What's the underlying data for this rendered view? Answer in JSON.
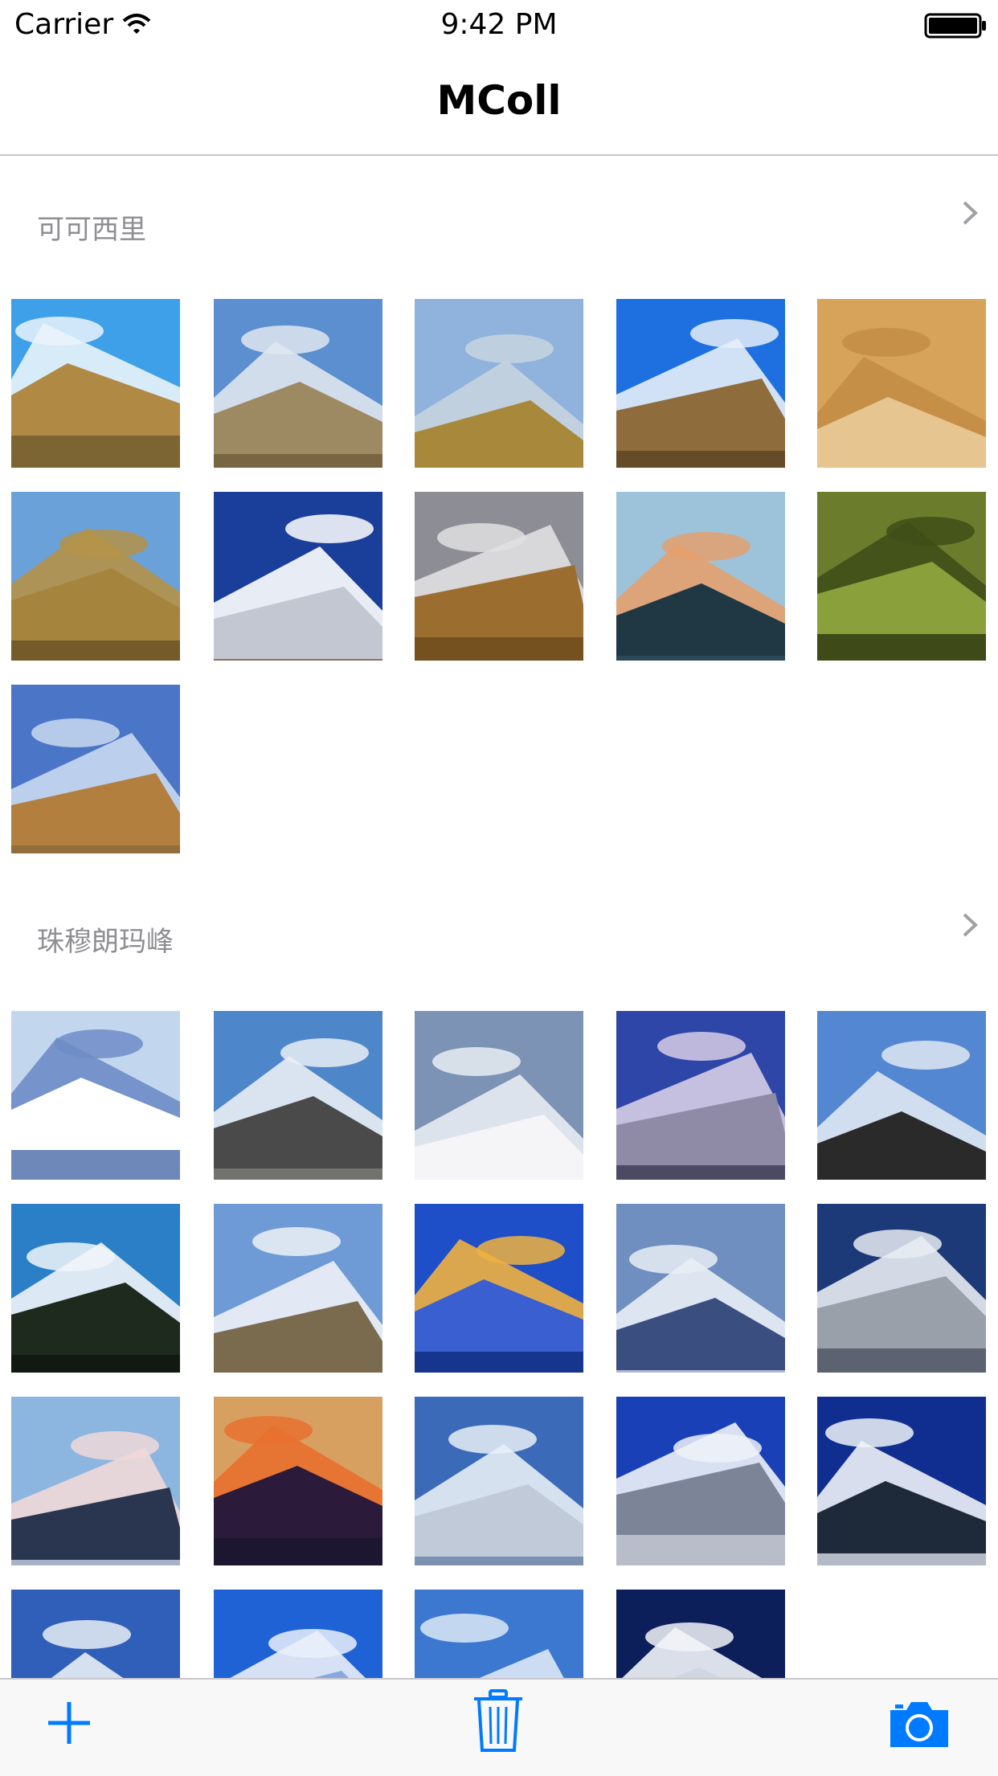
{
  "status_bar": {
    "carrier": "Carrier",
    "time": "9:42 PM"
  },
  "nav": {
    "title": "MColl"
  },
  "sections": [
    {
      "title": "可可西里",
      "photos": [
        {
          "name": "lake-shore-photo"
        },
        {
          "name": "cloudy-hill-photo"
        },
        {
          "name": "antelope-herd-photo"
        },
        {
          "name": "blue-sky-plain-photo"
        },
        {
          "name": "alpaca-photo"
        },
        {
          "name": "antelope-grassland-photo"
        },
        {
          "name": "snow-peak-photo"
        },
        {
          "name": "storm-plain-photo"
        },
        {
          "name": "sunset-lake-photo"
        },
        {
          "name": "forest-photo"
        },
        {
          "name": "deer-photo"
        }
      ]
    },
    {
      "title": "珠穆朗玛峰",
      "photos": [
        {
          "name": "cloud-sea-photo"
        },
        {
          "name": "rocky-ridge-photo"
        },
        {
          "name": "climber-slope-photo"
        },
        {
          "name": "purple-peak-photo"
        },
        {
          "name": "everest-river-photo"
        },
        {
          "name": "tree-silhouette-peak-photo"
        },
        {
          "name": "stupa-peak-photo"
        },
        {
          "name": "golden-peak-photo"
        },
        {
          "name": "cloudy-valley-photo"
        },
        {
          "name": "snow-massif-photo"
        },
        {
          "name": "pink-peak-photo"
        },
        {
          "name": "sunset-peak-photo"
        },
        {
          "name": "aerial-range-photo"
        },
        {
          "name": "wing-view-photo"
        },
        {
          "name": "cloud-peak-photo"
        },
        {
          "name": "blue-peak-photo"
        },
        {
          "name": "sky-range-photo"
        },
        {
          "name": "distant-peak-photo"
        },
        {
          "name": "white-clouds-photo"
        }
      ]
    }
  ],
  "toolbar": {
    "add_icon": "plus-icon",
    "trash_icon": "trash-icon",
    "camera_icon": "camera-icon"
  },
  "colors": {
    "accent": "#007aff",
    "section_title": "#8e8e93",
    "separator": "#c8c7cc"
  }
}
